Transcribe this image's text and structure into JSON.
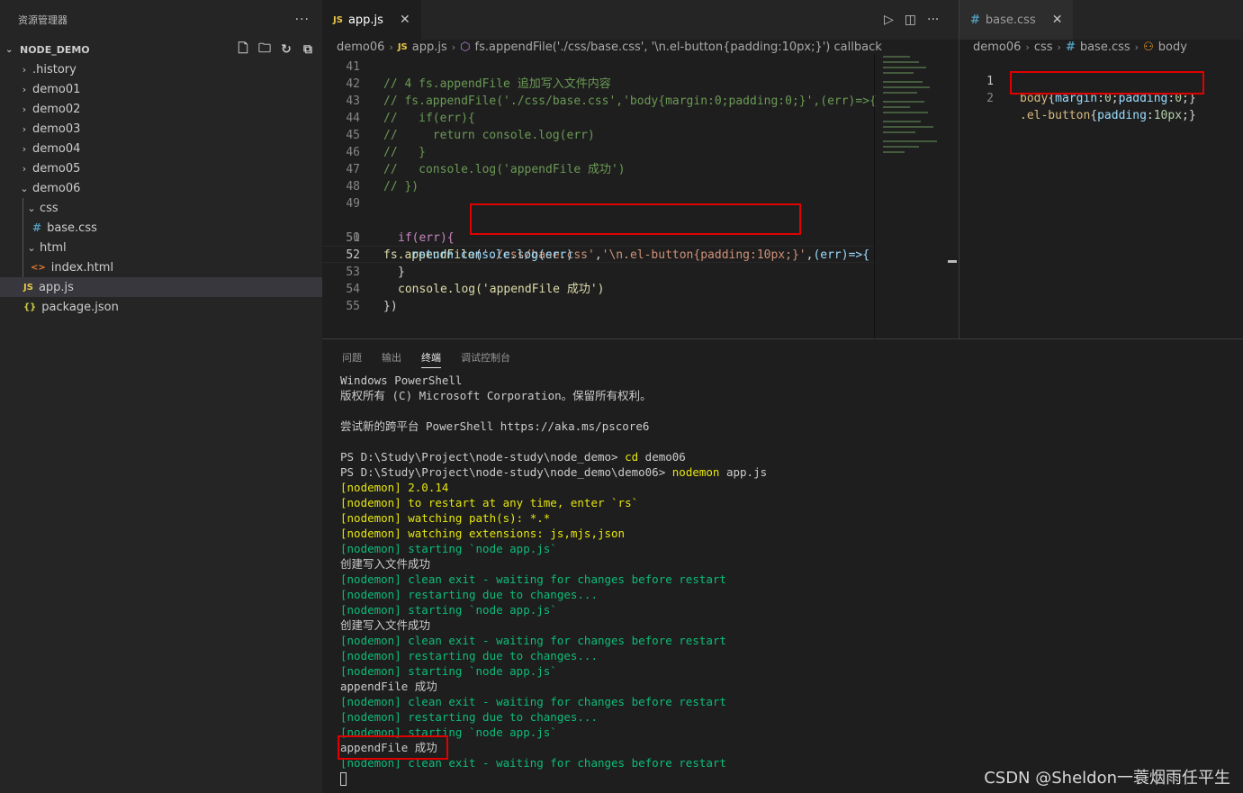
{
  "sidebar": {
    "title": "资源管理器",
    "more": "···",
    "project": "NODE_DEMO",
    "items": [
      {
        "label": ".history"
      },
      {
        "label": "demo01"
      },
      {
        "label": "demo02"
      },
      {
        "label": "demo03"
      },
      {
        "label": "demo04"
      },
      {
        "label": "demo05"
      },
      {
        "label": "demo06"
      },
      {
        "label": "css"
      },
      {
        "label": "base.css",
        "icon": "#"
      },
      {
        "label": "html"
      },
      {
        "label": "index.html",
        "icon": "<>"
      },
      {
        "label": "app.js",
        "icon": "JS"
      },
      {
        "label": "package.json",
        "icon": "{}"
      }
    ]
  },
  "editor_left": {
    "tab": {
      "icon": "JS",
      "label": "app.js"
    },
    "breadcrumb": [
      "demo06",
      "app.js",
      "fs.appendFile('./css/base.css', '\\n.el-button{padding:10px;}') callback"
    ],
    "lines": [
      {
        "n": "41",
        "text": ""
      },
      {
        "n": "42",
        "text": "// 4 fs.appendFile 追加写入文件内容"
      },
      {
        "n": "43",
        "text": "// fs.appendFile('./css/base.css','body{margin:0;padding:0;}',(err)=>{"
      },
      {
        "n": "44",
        "text": "//   if(err){"
      },
      {
        "n": "45",
        "text": "//     return console.log(err)"
      },
      {
        "n": "46",
        "text": "//   }"
      },
      {
        "n": "47",
        "text": "//   console.log('appendFile 成功')"
      },
      {
        "n": "48",
        "text": "// })"
      },
      {
        "n": "49",
        "text": ""
      },
      {
        "n": "50",
        "fn": "fs.appendFile",
        "str1": "'./css/base.css'",
        "str2": "'\\n.el-button{padding:10px;}'",
        "rest": "(err)=>{"
      },
      {
        "n": "51",
        "text": "if(err){"
      },
      {
        "n": "52",
        "text": "return console.log(err)"
      },
      {
        "n": "53",
        "text": "}"
      },
      {
        "n": "54",
        "text": "console.log('appendFile 成功')"
      },
      {
        "n": "55",
        "text": "})"
      }
    ]
  },
  "editor_right": {
    "tab": {
      "icon": "#",
      "label": "base.css"
    },
    "breadcrumb": [
      "demo06",
      "css",
      "base.css",
      "body"
    ],
    "lines": [
      {
        "n": "1",
        "selector": "body",
        "prop1": "margin",
        "val1": "0",
        "prop2": "padding",
        "val2": "0"
      },
      {
        "n": "2",
        "selector": ".el-button",
        "prop1": "padding",
        "val1": "10px"
      }
    ]
  },
  "panel": {
    "tabs": [
      "问题",
      "输出",
      "终端",
      "调试控制台"
    ],
    "active_tab": "终端",
    "terminal": [
      {
        "text": "Windows PowerShell",
        "style": "plain"
      },
      {
        "text": "版权所有 (C) Microsoft Corporation。保留所有权利。",
        "style": "plain"
      },
      {
        "text": "",
        "style": "plain"
      },
      {
        "text": "尝试新的跨平台 PowerShell https://aka.ms/pscore6",
        "style": "plain"
      },
      {
        "text": "",
        "style": "plain"
      },
      {
        "prompt": "PS D:\\Study\\Project\\node-study\\node_demo> ",
        "cmd": "cd",
        "args": " demo06",
        "style": "prompt"
      },
      {
        "prompt": "PS D:\\Study\\Project\\node-study\\node_demo\\demo06> ",
        "cmd": "nodemon",
        "args": " app.js",
        "style": "prompt"
      },
      {
        "text": "[nodemon] 2.0.14",
        "style": "yellow"
      },
      {
        "text": "[nodemon] to restart at any time, enter `rs`",
        "style": "yellow"
      },
      {
        "text": "[nodemon] watching path(s): *.*",
        "style": "yellow"
      },
      {
        "text": "[nodemon] watching extensions: js,mjs,json",
        "style": "yellow"
      },
      {
        "text": "[nodemon] starting `node app.js`",
        "style": "green"
      },
      {
        "text": "创建写入文件成功",
        "style": "plain"
      },
      {
        "text": "[nodemon] clean exit - waiting for changes before restart",
        "style": "green"
      },
      {
        "text": "[nodemon] restarting due to changes...",
        "style": "green"
      },
      {
        "text": "[nodemon] starting `node app.js`",
        "style": "green"
      },
      {
        "text": "创建写入文件成功",
        "style": "plain"
      },
      {
        "text": "[nodemon] clean exit - waiting for changes before restart",
        "style": "green"
      },
      {
        "text": "[nodemon] restarting due to changes...",
        "style": "green"
      },
      {
        "text": "[nodemon] starting `node app.js`",
        "style": "green"
      },
      {
        "text": "appendFile 成功",
        "style": "plain"
      },
      {
        "text": "[nodemon] clean exit - waiting for changes before restart",
        "style": "green"
      },
      {
        "text": "[nodemon] restarting due to changes...",
        "style": "green"
      },
      {
        "text": "[nodemon] starting `node app.js`",
        "style": "green"
      },
      {
        "text": "appendFile 成功",
        "style": "plain"
      },
      {
        "text": "[nodemon] clean exit - waiting for changes before restart",
        "style": "green"
      }
    ]
  },
  "watermark": "CSDN @Sheldon一蓑烟雨任平生",
  "colors": {
    "highlight_box": "#e00000",
    "js_icon": "#e8c547",
    "css_icon": "#519aba"
  }
}
